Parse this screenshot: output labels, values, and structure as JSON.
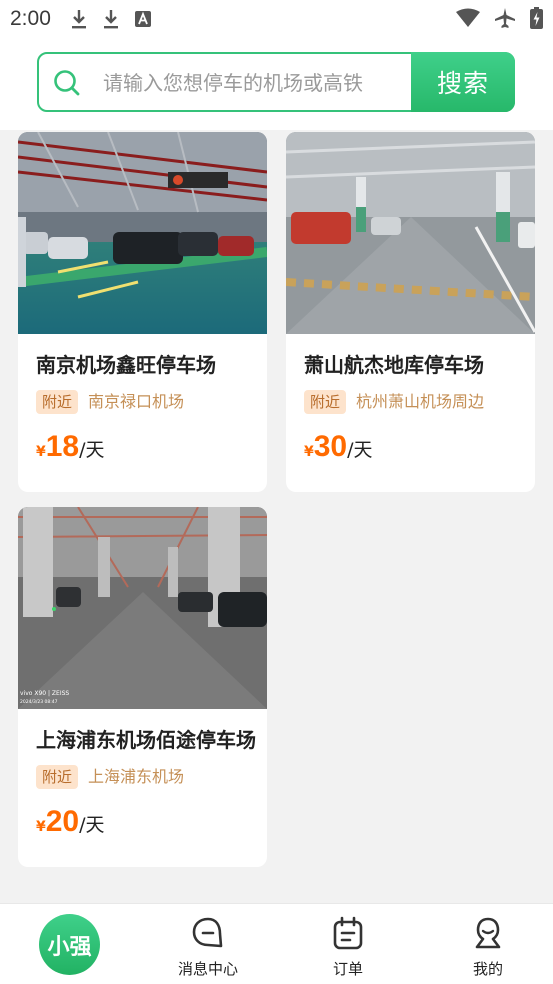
{
  "status_bar": {
    "time": "2:00",
    "left_icons": [
      "download-icon",
      "download-icon",
      "font-icon"
    ],
    "right_icons": [
      "wifi-icon",
      "airplane-mode-icon",
      "battery-charging-icon"
    ]
  },
  "search": {
    "placeholder": "请输入您想停车的机场或高铁",
    "button_label": "搜索",
    "accent_color": "#35c27a"
  },
  "parking_lots": [
    {
      "name": "南京机场鑫旺停车场",
      "tag": "附近",
      "location": "南京禄口机场",
      "currency": "¥",
      "price": "18",
      "unit": "/天"
    },
    {
      "name": "萧山航杰地库停车场",
      "tag": "附近",
      "location": "杭州萧山机场周边",
      "currency": "¥",
      "price": "30",
      "unit": "/天"
    },
    {
      "name": "上海浦东机场佰途停车场",
      "tag": "附近",
      "location": "上海浦东机场",
      "currency": "¥",
      "price": "20",
      "unit": "/天"
    }
  ],
  "photo_watermark": "vivo X90 | ZEISS",
  "photo_date": "2024/3/23 08:47",
  "tab_bar": {
    "home": "小强",
    "messages": "消息中心",
    "orders": "订单",
    "mine": "我的"
  },
  "colors": {
    "price": "#ff6a00",
    "tag_bg": "#fde3cc",
    "tag_text": "#b86d2c",
    "location_text": "#c59057",
    "brand_green": "#2fbf72"
  }
}
